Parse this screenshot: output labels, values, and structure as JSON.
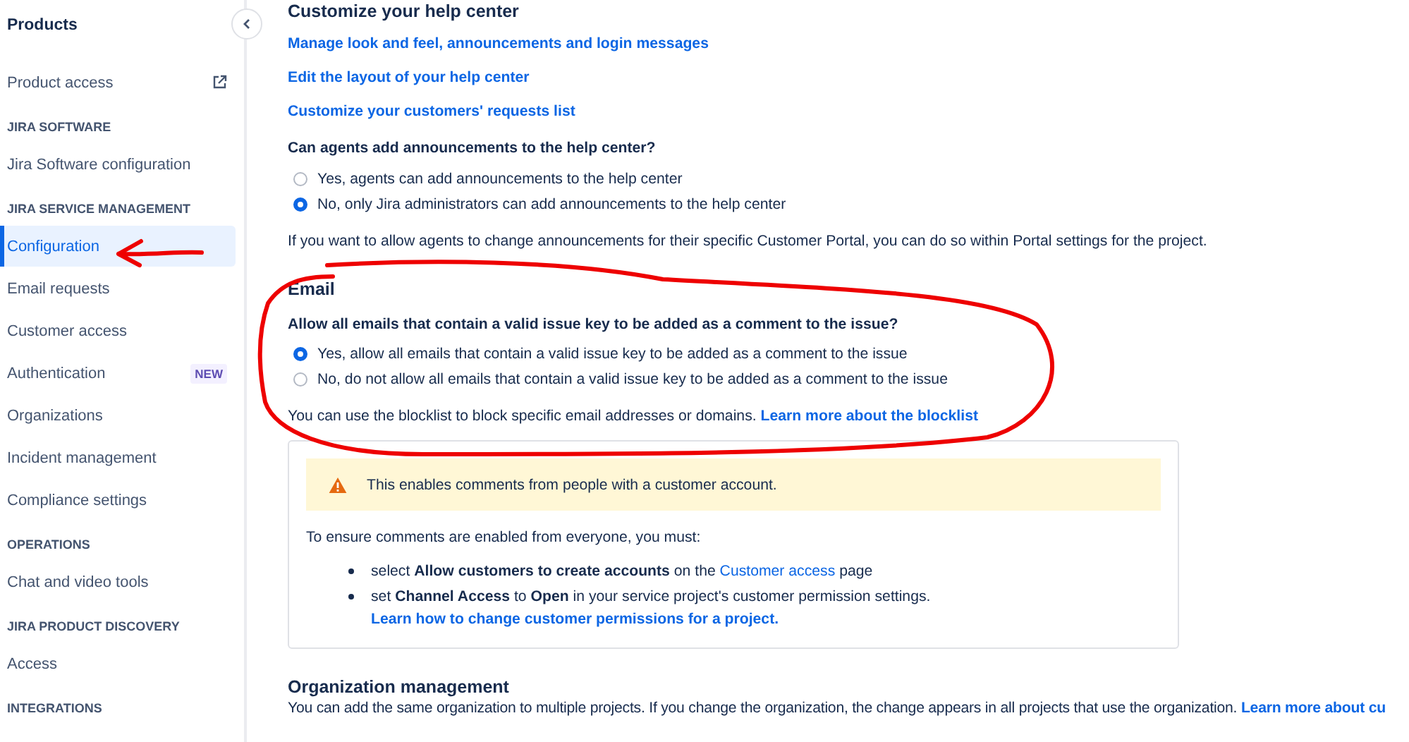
{
  "sidebar": {
    "title": "Products",
    "sections": [
      {
        "items": [
          {
            "label": "Product access",
            "kind": "external",
            "selected": false
          }
        ]
      },
      {
        "heading": "JIRA SOFTWARE",
        "items": [
          {
            "label": "Jira Software configuration",
            "kind": "plain",
            "selected": false
          }
        ]
      },
      {
        "heading": "JIRA SERVICE MANAGEMENT",
        "items": [
          {
            "label": "Configuration",
            "kind": "plain",
            "selected": true
          },
          {
            "label": "Email requests",
            "kind": "plain",
            "selected": false
          },
          {
            "label": "Customer access",
            "kind": "plain",
            "selected": false
          },
          {
            "label": "Authentication",
            "kind": "plain",
            "selected": false,
            "badge": "NEW"
          },
          {
            "label": "Organizations",
            "kind": "plain",
            "selected": false
          },
          {
            "label": "Incident management",
            "kind": "plain",
            "selected": false
          },
          {
            "label": "Compliance settings",
            "kind": "plain",
            "selected": false
          }
        ]
      },
      {
        "heading": "OPERATIONS",
        "items": [
          {
            "label": "Chat and video tools",
            "kind": "plain",
            "selected": false
          }
        ]
      },
      {
        "heading": "JIRA PRODUCT DISCOVERY",
        "items": [
          {
            "label": "Access",
            "kind": "plain",
            "selected": false
          }
        ]
      },
      {
        "heading": "INTEGRATIONS"
      }
    ]
  },
  "help_center": {
    "title": "Customize your help center",
    "links": [
      "Manage look and feel, announcements and login messages",
      "Edit the layout of your help center",
      "Customize your customers' requests list"
    ],
    "question": "Can agents add announcements to the help center?",
    "options": [
      {
        "label": "Yes, agents can add announcements to the help center",
        "selected": false
      },
      {
        "label": "No, only Jira administrators can add announcements to the help center",
        "selected": true
      }
    ],
    "note": "If you want to allow agents to change announcements for their specific Customer Portal, you can do so within Portal settings for the project."
  },
  "email": {
    "title": "Email",
    "question": "Allow all emails that contain a valid issue key to be added as a comment to the issue?",
    "options": [
      {
        "label": "Yes, allow all emails that contain a valid issue key to be added as a comment to the issue",
        "selected": true
      },
      {
        "label": "No, do not allow all emails that contain a valid issue key to be added as a comment to the issue",
        "selected": false
      }
    ],
    "note": {
      "text": "You can use the blocklist to block specific email addresses or domains.",
      "link": "Learn more about the blocklist"
    },
    "info_panel": {
      "warning": "This enables comments from people with a customer account.",
      "intro": "To ensure comments are enabled from everyone, you must:",
      "steps": [
        {
          "parts": [
            {
              "kind": "text",
              "text": "select **Allow customers to create accounts** on the "
            },
            {
              "kind": "link",
              "text": "Customer access"
            },
            {
              "kind": "text",
              "text": " page"
            }
          ]
        },
        {
          "parts": [
            {
              "kind": "text",
              "text": "set **Channel Access** to **Open** in your service project's customer permission settings."
            },
            {
              "kind": "block_link",
              "text": "Learn how to change customer permissions for a project."
            }
          ]
        }
      ]
    }
  },
  "organization": {
    "title": "Organization management",
    "note": {
      "text": "You can add the same organization to multiple projects. If you change the organization, the change appears in all projects that use the organization.",
      "link": "Learn more about cu"
    }
  }
}
